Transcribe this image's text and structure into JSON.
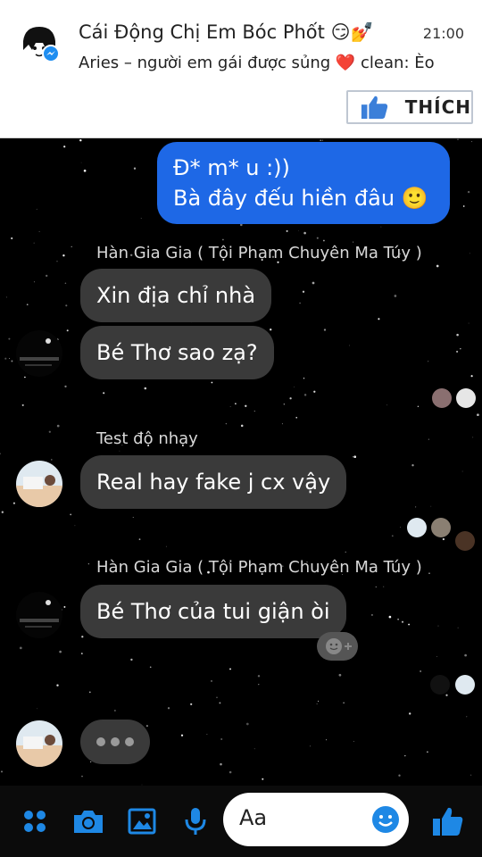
{
  "notification": {
    "title": "Cái Động Chị Em Bóc Phốt 😏💅",
    "time": "21:00",
    "body": "Aries – người em gái được sủng ❤️ clean: Èo",
    "like_label": "THÍCH"
  },
  "messages": {
    "out1_line1": "Đ* m* u :))",
    "out1_line2": "Bà đây đếu hiền đâu 🙂",
    "sender1": "Hàn Gia Gia ( Tội Phạm Chuyên Ma Túy )",
    "in1": "Xin địa chỉ nhà",
    "in2": "Bé Thơ sao zạ?",
    "sender2": "Test độ nhạy",
    "in3": "Real hay fake j cx vậy",
    "sender3": "Hàn Gia Gia ( Tội Phạm Chuyên Ma Túy )",
    "in4": "Bé Thơ của tui giận òi"
  },
  "composer": {
    "placeholder": "Aa"
  },
  "colors": {
    "outgoing_bubble": "#1e68e6",
    "incoming_bubble": "#3a3a3a",
    "accent": "#1e88e5"
  }
}
